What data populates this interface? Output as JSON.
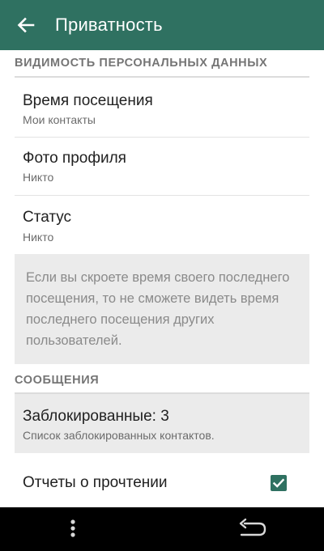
{
  "toolbar": {
    "title": "Приватность",
    "back_icon": "arrow-left-icon"
  },
  "sections": {
    "personal": "ВИДИМОСТЬ ПЕРСОНАЛЬНЫХ ДАННЫХ",
    "messages": "СООБЩЕНИЯ"
  },
  "items": {
    "last_seen": {
      "title": "Время посещения",
      "summary": "Мои контакты"
    },
    "profile_photo": {
      "title": "Фото профиля",
      "summary": "Никто"
    },
    "status": {
      "title": "Статус",
      "summary": "Никто"
    },
    "blocked": {
      "title": "Заблокированные: 3",
      "summary": "Список заблокированных контактов."
    },
    "read_receipts": {
      "title": "Отчеты о прочтении",
      "checked": true
    }
  },
  "info": {
    "text": "Если вы скроете время своего последнего посещения, то не сможете видеть время последнего посещения других пользователей."
  },
  "colors": {
    "accent": "#2f7161",
    "info_bg": "#ebebeb"
  },
  "navbar": {
    "menu_icon": "more-vertical-icon",
    "back_icon": "nav-back-icon"
  }
}
